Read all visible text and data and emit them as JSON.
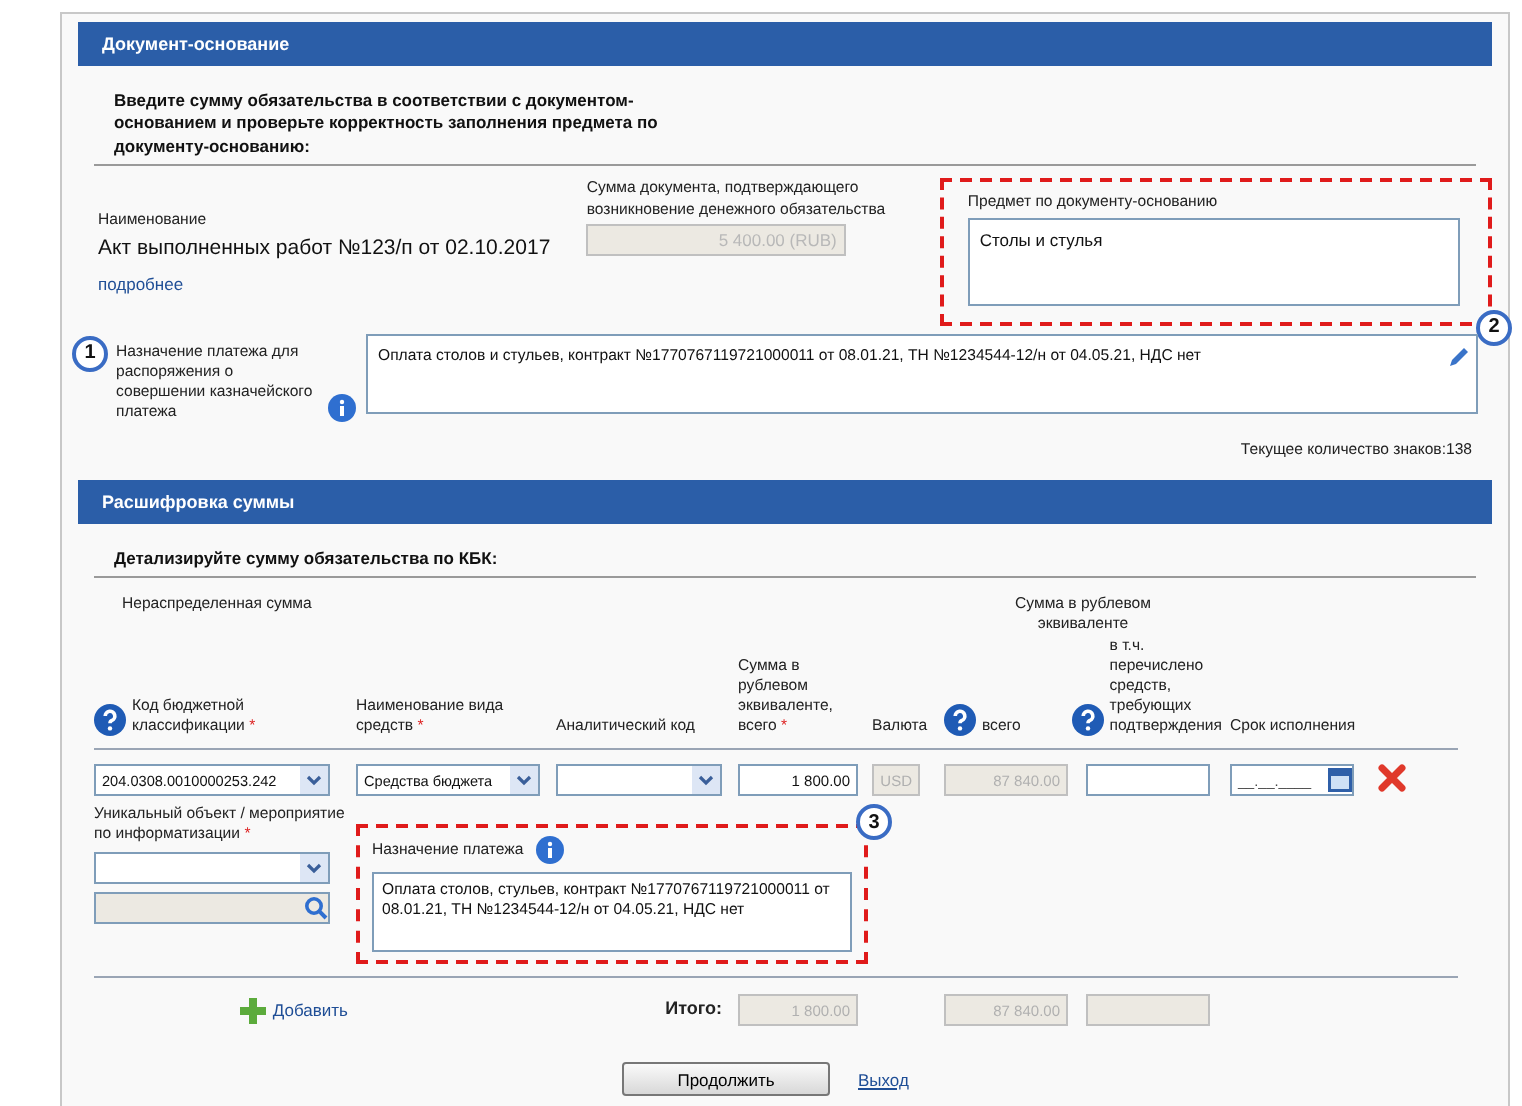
{
  "basis": {
    "title": "Документ-основание",
    "instruction": "Введите сумму обязательства в соответствии с документом-основанием и проверьте корректность заполнения предмета по документу-основанию:",
    "name_label": "Наименование",
    "name_value": "Акт выполненных работ №123/п от 02.10.2017",
    "more_link": "подробнее",
    "sum_label": "Сумма документа, подтверждающего возникновение денежного обязательства",
    "sum_value": "5 400.00 (RUB)",
    "subject_label": "Предмет по документу-основанию",
    "subject_value": "Столы и стулья",
    "subject_callout": "2"
  },
  "purpose": {
    "callout": "1",
    "label": "Назначение платежа для распоряжения о совершении казначейского платежа",
    "value": "Оплата столов и стульев, контракт №1770767119721000011 от 08.01.21, ТН №1234544-12/н от 04.05.21, НДС нет",
    "char_count": "Текущее количество знаков:138"
  },
  "breakdown": {
    "title": "Расшифровка суммы",
    "instruction": "Детализируйте сумму обязательства по КБК:",
    "unallocated": "Нераспределенная сумма",
    "group_header": "Сумма в рублевом эквиваленте",
    "required_mark": "*",
    "columns": [
      {
        "label": "Код бюджетной классификации",
        "required": true,
        "help": true
      },
      {
        "label": "Наименование вида средств",
        "required": true,
        "help": false
      },
      {
        "label": "Аналитический код",
        "required": false,
        "help": false
      },
      {
        "label": "Сумма в рублевом эквиваленте, всего",
        "required": true,
        "help": false
      },
      {
        "label": "Валюта",
        "required": false,
        "help": false
      },
      {
        "label": "всего",
        "required": false,
        "help": true
      },
      {
        "label": "в т.ч. перечислено средств, требующих подтверждения",
        "required": false,
        "help": true
      },
      {
        "label": "Срок исполнения",
        "required": false,
        "help": false
      }
    ],
    "row": {
      "kbk": "204.0308.0010000253.242",
      "fund": "Средства бюджета",
      "sum": "1 800.00",
      "currency": "USD",
      "total": "87 840.00",
      "date_placeholder": "__.__.____"
    },
    "unique_object": {
      "label": "Уникальный объект / мероприятие по информатизации",
      "required": true
    },
    "payment_purpose": {
      "label": "Назначение платежа",
      "value": "Оплата столов, стульев, контракт №1770767119721000011 от 08.01.21, ТН №1234544-12/н от 04.05.21, НДС нет",
      "callout": "3"
    },
    "add": "Добавить",
    "total_label": "Итого:",
    "totals": [
      "1 800.00",
      "87 840.00"
    ]
  },
  "actions": {
    "continue": "Продолжить",
    "exit": "Выход"
  }
}
